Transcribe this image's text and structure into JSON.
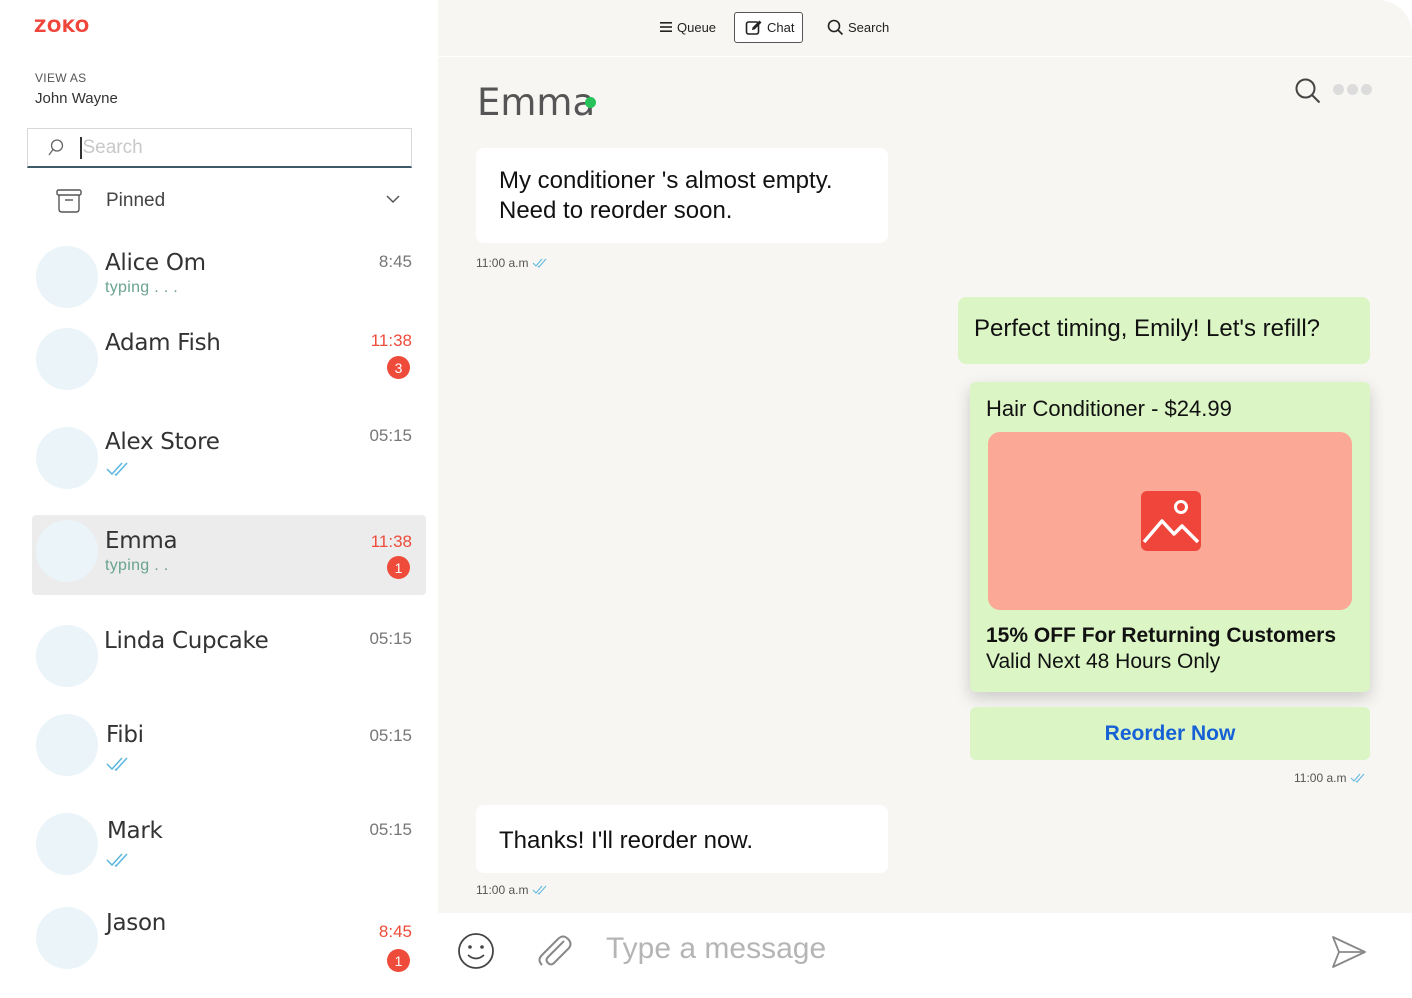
{
  "app": {
    "logo_text": "ZOKO"
  },
  "nav": {
    "queue_label": "Queue",
    "chat_label": "Chat",
    "search_label": "Search"
  },
  "sidebar": {
    "view_as_label": "VIEW AS",
    "view_as_name": "John Wayne",
    "search_placeholder": "Search",
    "pinned_label": "Pinned",
    "chats": [
      {
        "name": "Alice Om",
        "sub": "typing . . .",
        "time": "8:45",
        "unread_count": "",
        "ticks": false,
        "active": false
      },
      {
        "name": "Adam Fish",
        "sub": "",
        "time": "11:38",
        "unread_count": "3",
        "ticks": false,
        "active": false
      },
      {
        "name": "Alex Store",
        "sub": "",
        "time": "05:15",
        "unread_count": "",
        "ticks": true,
        "active": false
      },
      {
        "name": "Emma",
        "sub": "typing . .",
        "time": "11:38",
        "unread_count": "1",
        "ticks": false,
        "active": true
      },
      {
        "name": "Linda Cupcake",
        "sub": "",
        "time": "05:15",
        "unread_count": "",
        "ticks": false,
        "active": false
      },
      {
        "name": "Fibi",
        "sub": "",
        "time": "05:15",
        "unread_count": "",
        "ticks": true,
        "active": false
      },
      {
        "name": "Mark",
        "sub": "",
        "time": "05:15",
        "unread_count": "",
        "ticks": true,
        "active": false
      },
      {
        "name": "Jason",
        "sub": "",
        "time": "8:45",
        "unread_count": "1",
        "ticks": false,
        "active": false
      }
    ]
  },
  "conversation": {
    "contact_name": "Emma",
    "online": true,
    "messages": {
      "m1_line1": "My conditioner 's almost empty.",
      "m1_line2": "Need to reorder soon.",
      "m1_time": "11:00 a.m",
      "m2_text": "Perfect timing, Emily! Let's refill?",
      "m3_time": "11:00 a.m",
      "m4_text": "Thanks! I'll reorder now.",
      "m4_time": "11:00 a.m"
    },
    "product_card": {
      "title": "Hair Conditioner - $24.99",
      "promo_title": "15% OFF For Returning Customers",
      "promo_sub": "Valid Next 48 Hours Only",
      "button_label": "Reorder Now"
    }
  },
  "composer": {
    "placeholder": "Type a message"
  },
  "colors": {
    "brand": "#f0453a",
    "unread": "#ef4b3a",
    "online": "#27c25a",
    "outgoing_bubble": "#dcf5c5",
    "product_image": "#fca897",
    "link_button": "#1761d6",
    "typing": "#6aa38f",
    "ticks": "#5bb6e0"
  }
}
